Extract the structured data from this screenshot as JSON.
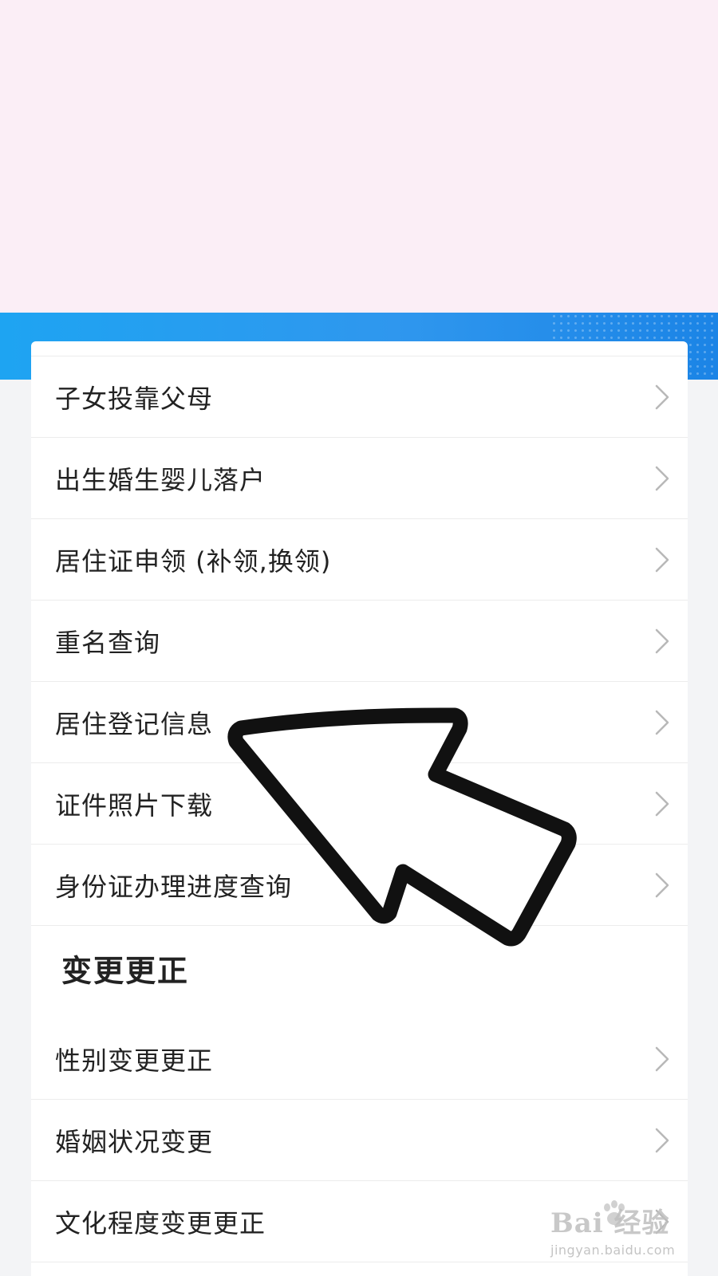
{
  "menu_items_a": [
    {
      "label": "子女投靠父母"
    },
    {
      "label": "出生婚生婴儿落户"
    },
    {
      "label": "居住证申领 (补领,换领)"
    },
    {
      "label": "重名查询"
    },
    {
      "label": "居住登记信息"
    },
    {
      "label": "证件照片下载"
    },
    {
      "label": "身份证办理进度查询"
    }
  ],
  "section": {
    "title": "变更更正"
  },
  "menu_items_b": [
    {
      "label": "性别变更更正"
    },
    {
      "label": "婚姻状况变更"
    },
    {
      "label": "文化程度变更更正"
    }
  ],
  "watermark": {
    "brand": "Bai 经验",
    "url": "jingyan.baidu.com"
  },
  "colors": {
    "banner": "#fbeef6",
    "blue_band": "#1ea4f2",
    "text": "#222222",
    "chevron": "#b8b8b8",
    "annotation_arrow": "#111111"
  },
  "icons": {
    "chevron": "chevron-right-icon",
    "annotation": "pointer-arrow-icon",
    "watermark_logo": "baidu-paw-icon"
  }
}
